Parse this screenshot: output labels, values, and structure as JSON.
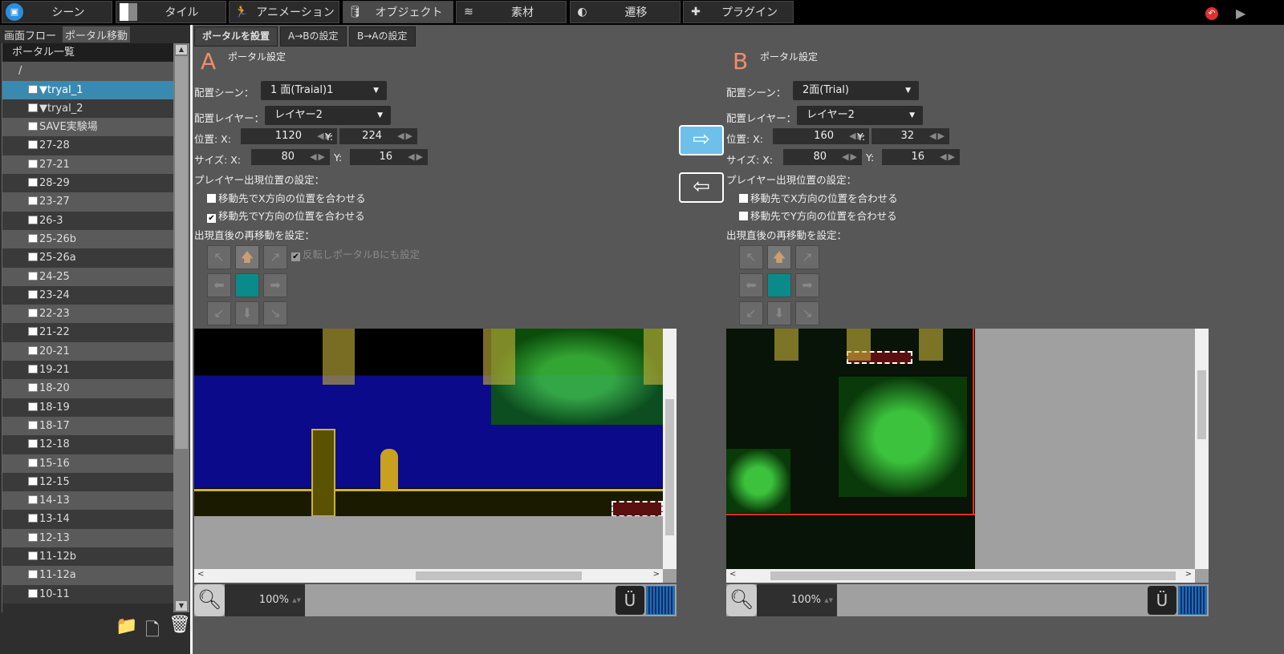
{
  "topbar": {
    "tabs": [
      {
        "label": "シーン",
        "icon": "scene-icon"
      },
      {
        "label": "タイル",
        "icon": "tile-icon"
      },
      {
        "label": "アニメーション",
        "icon": "animation-icon"
      },
      {
        "label": "オブジェクト",
        "icon": "object-icon",
        "active": true
      },
      {
        "label": "素材",
        "icon": "material-icon"
      },
      {
        "label": "遷移",
        "icon": "transition-icon"
      },
      {
        "label": "プラグイン",
        "icon": "plugin-icon"
      }
    ]
  },
  "left": {
    "tabs": [
      "画面フロー",
      "ポータル移動"
    ],
    "header": "ポータル一覧",
    "root": "/",
    "items": [
      "▼tryal_1",
      "▼tryal_2",
      "SAVE実験場",
      "27-28",
      "27-21",
      "28-29",
      "23-27",
      "26-3",
      "25-26b",
      "25-26a",
      "24-25",
      "23-24",
      "22-23",
      "21-22",
      "20-21",
      "19-21",
      "18-20",
      "18-19",
      "18-17",
      "12-18",
      "15-16",
      "12-15",
      "14-13",
      "13-14",
      "12-13",
      "11-12b",
      "11-12a",
      "10-11"
    ],
    "selected": 0
  },
  "subtabs": [
    "ポータルを設置",
    "A→Bの設定",
    "B→Aの設定"
  ],
  "labels": {
    "title": "ポータル設定",
    "scene": "配置シーン：",
    "layer": "配置レイヤー：",
    "pos": "位置:  X:",
    "size": "サイズ:  X:",
    "y": "Y:",
    "player": "プレイヤー出現位置の設定：",
    "matchX": "移動先でX方向の位置を合わせる",
    "matchY": "移動先でY方向の位置を合わせる",
    "remove": "出現直後の再移動を設定：",
    "mirror": "反転しポータルBにも設定"
  },
  "a": {
    "letter": "A",
    "scene": "1 面(Traial)1",
    "layer": "レイヤー2",
    "x": "1120",
    "y": "224",
    "w": "80",
    "h": "16",
    "matchX": false,
    "matchY": true,
    "zoom": "100%"
  },
  "b": {
    "letter": "B",
    "scene": "2面(Trial)",
    "layer": "レイヤー2",
    "x": "160",
    "y": "32",
    "w": "80",
    "h": "16",
    "matchX": false,
    "matchY": false,
    "zoom": "100%"
  },
  "arrows": {
    "right": "⇨",
    "left": "⇦"
  }
}
